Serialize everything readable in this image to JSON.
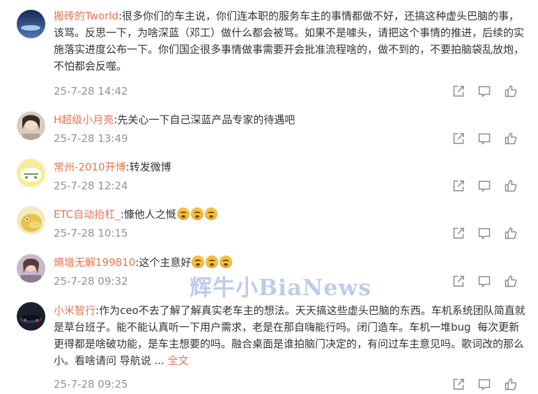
{
  "comments": [
    {
      "user": "搬砖的Tworld",
      "text": ":很多你们的车主说，你们连本职的服务车主的事情都做不好，还搞这种虚头巴脑的事，该骂。反思一下，为啥深蓝（邓工）做什么都会被骂。如果不是噱头，请把这个事情的推进，后续的实施落实进度公布一下。你们国企很多事情做事需要开会批准流程啥的，做不到的，不要拍脑袋乱放炮，不怕都会反噬。",
      "time": "25-7-28 14:42"
    },
    {
      "user": "H超级小月亮",
      "text": ":先关心一下自己深蓝产品专家的待遇吧",
      "time": "25-7-28 13:49"
    },
    {
      "user": "常州-2010开博",
      "text": ":转发微博",
      "time": "25-7-28 12:24"
    },
    {
      "user": "ETC自动抬杠_",
      "text": ":慷他人之慨",
      "time": "25-7-28 10:15"
    },
    {
      "user": "熵增无解199810",
      "text": ":这个主意好",
      "time": "25-7-28 09:32"
    },
    {
      "user": "小米智行",
      "text": ":作为ceo不去了解了解真实老车主的想法。天天搞这些虚头巴脑的东西。车机系统团队简直就是草台班子。能不能认真听一下用户需求，老是在那自嗨能行吗。闭门造车。车机一堆bug  每次更新更得都是啥破功能，是车主想要的吗。融合桌面是谁拍脑门决定的，有问过车主意见吗。歌词改的那么小。看啥请问 导航说 ... ",
      "more": "全文",
      "time": "25-7-28 09:25"
    }
  ],
  "watermark": "辉牛小BiaNews",
  "icons": {
    "share": "share-icon",
    "comment": "comment-icon",
    "like": "thumbs-up-icon"
  },
  "colors": {
    "username": "#eb7350",
    "text": "#333333",
    "time": "#939393",
    "icon": "#8a8a8a"
  }
}
